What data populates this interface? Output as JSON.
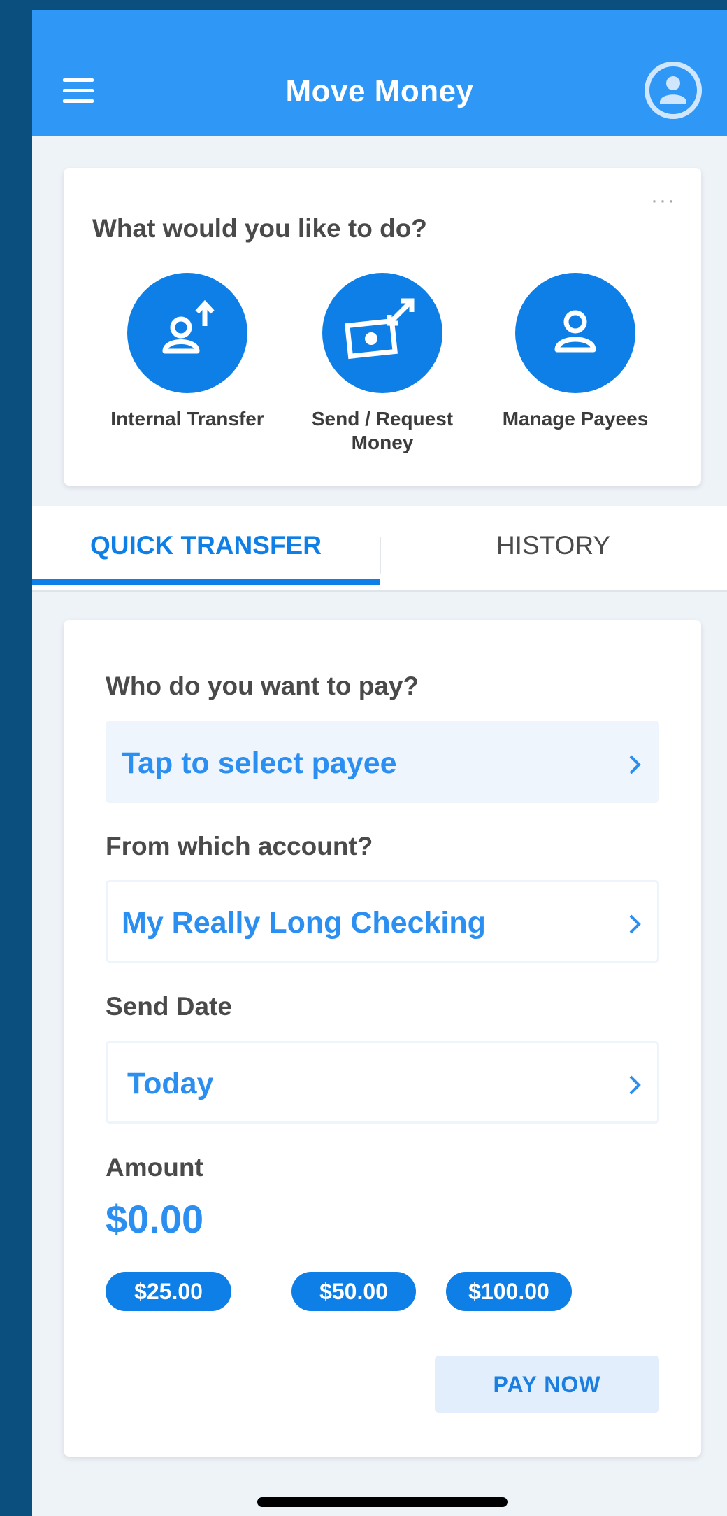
{
  "header": {
    "title": "Move Money",
    "menu_icon": "hamburger-menu-icon",
    "profile_icon": "user-avatar-icon"
  },
  "actions_card": {
    "question": "What would you like to do?",
    "more_icon": "more-horizontal-icon",
    "items": [
      {
        "label": "Internal Transfer",
        "icon": "person-upload-icon"
      },
      {
        "label": "Send / Request Money",
        "icon": "money-transfer-icon"
      },
      {
        "label": "Manage Payees",
        "icon": "person-icon"
      }
    ]
  },
  "tabs": [
    {
      "label": "QUICK TRANSFER",
      "active": true
    },
    {
      "label": "HISTORY",
      "active": false
    }
  ],
  "transfer": {
    "payee_label": "Who do you want to pay?",
    "payee_value": "Tap to select payee",
    "account_label": "From which account?",
    "account_value": "My Really Long Checking",
    "date_label": "Send Date",
    "date_value": "Today",
    "amount_label": "Amount",
    "amount_value": "$0.00",
    "quick_amounts": [
      "$25.00",
      "$50.00",
      "$100.00"
    ],
    "pay_button": "PAY NOW"
  },
  "colors": {
    "header_bg": "#2f98f7",
    "accent": "#0d7fe6",
    "link_text": "#2a8ff0",
    "outer_bg": "#0a4f7e"
  }
}
